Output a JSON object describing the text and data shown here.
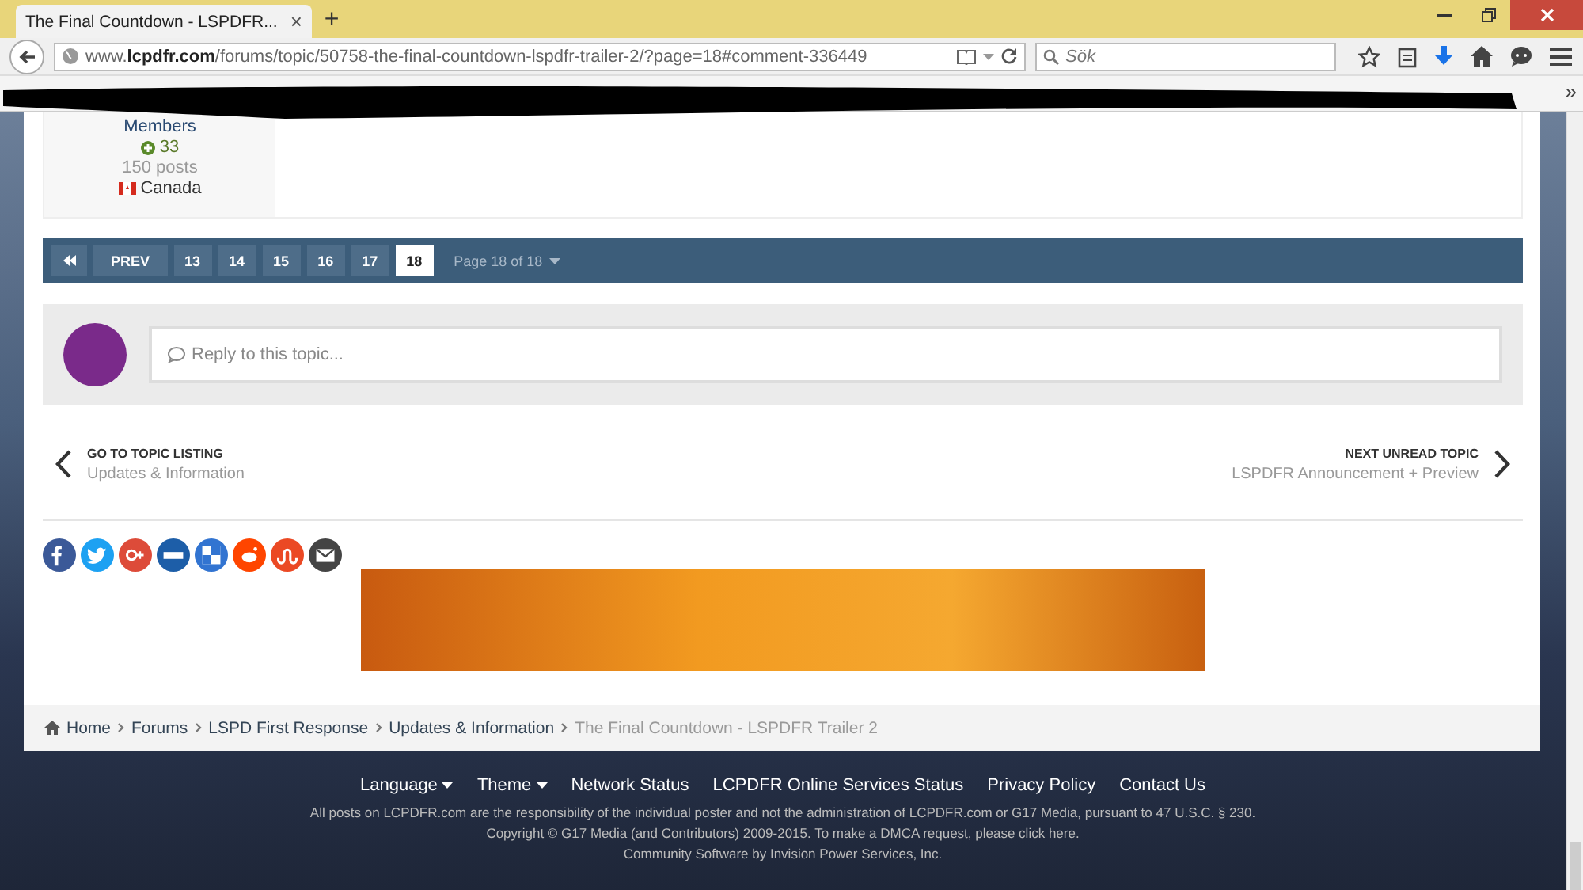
{
  "browser": {
    "tab_title": "The Final Countdown - LSPDFR...",
    "tab_close": "×",
    "new_tab": "+",
    "url": "www.**lcpdfr.com**/forums/topic/50758-the-final-countdown-lspdfr-trailer-2/?page=18#comment-336449",
    "search_placeholder": "Sök",
    "overflow": "»"
  },
  "author": {
    "group": "Members",
    "reputation": "33",
    "posts": "150 posts",
    "country": "Canada"
  },
  "pagination": {
    "pages": [
      {
        "label": "PREV",
        "kind": "prev",
        "selected": false
      },
      {
        "label": "13",
        "kind": "page",
        "selected": false
      },
      {
        "label": "14",
        "kind": "page",
        "selected": false
      },
      {
        "label": "15",
        "kind": "page",
        "selected": false
      },
      {
        "label": "16",
        "kind": "page",
        "selected": false
      },
      {
        "label": "17",
        "kind": "page",
        "selected": false
      },
      {
        "label": "18",
        "kind": "page",
        "selected": true
      }
    ],
    "page_info": "Page 18 of 18"
  },
  "reply": {
    "placeholder": "Reply to this topic..."
  },
  "topic_nav": {
    "prev_label": "GO TO TOPIC LISTING",
    "prev_title": "Updates & Information",
    "next_label": "NEXT UNREAD TOPIC",
    "next_title": "LSPDFR Announcement + Preview"
  },
  "share": [
    {
      "kind": "facebook",
      "color": "#3b5998"
    },
    {
      "kind": "twitter",
      "color": "#1da1f2"
    },
    {
      "kind": "googleplus",
      "color": "#dd4b39"
    },
    {
      "kind": "digg",
      "color": "#1d5ea8"
    },
    {
      "kind": "delicious",
      "color": "#3274d1"
    },
    {
      "kind": "reddit",
      "color": "#ff4500"
    },
    {
      "kind": "stumbleupon",
      "color": "#eb4924"
    },
    {
      "kind": "email",
      "color": "#444444"
    }
  ],
  "breadcrumb": [
    {
      "label": "Home",
      "current": false
    },
    {
      "label": "Forums",
      "current": false
    },
    {
      "label": "LSPD First Response",
      "current": false
    },
    {
      "label": "Updates & Information",
      "current": false
    },
    {
      "label": "The Final Countdown - LSPDFR Trailer 2",
      "current": true
    }
  ],
  "footer": {
    "links": [
      {
        "label": "Language",
        "dropdown": true
      },
      {
        "label": "Theme",
        "dropdown": true
      },
      {
        "label": "Network Status",
        "dropdown": false
      },
      {
        "label": "LCPDFR Online Services Status",
        "dropdown": false
      },
      {
        "label": "Privacy Policy",
        "dropdown": false
      },
      {
        "label": "Contact Us",
        "dropdown": false
      }
    ],
    "lines": [
      "All posts on LCPDFR.com are the responsibility of the individual poster and not the administration of LCPDFR.com or G17 Media, pursuant to 47 U.S.C. § 230.",
      "Copyright © G17 Media (and Contributors) 2009-2015. To make a DMCA request, please click here.",
      "Community Software by Invision Power Services, Inc."
    ]
  }
}
